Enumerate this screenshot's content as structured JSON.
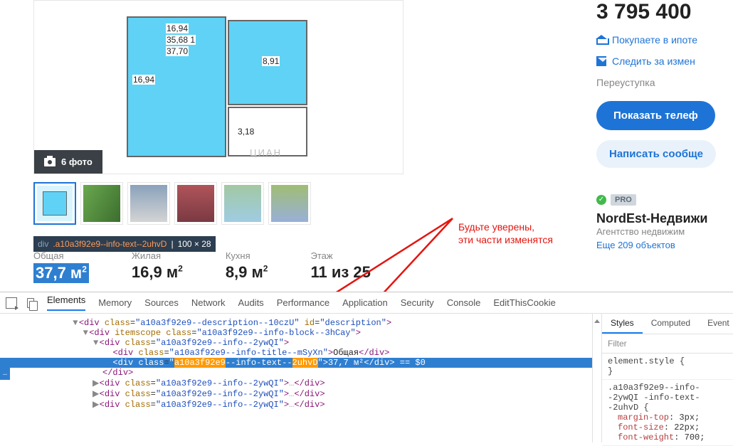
{
  "floorplan": {
    "labels": [
      "16,94",
      "35,68  1",
      "37,70",
      "16,94",
      "8,91",
      "3,18"
    ],
    "watermark": "ЦИАН"
  },
  "photo_badge": "6 фото",
  "thumbs_count": 6,
  "tooltip": {
    "prefix": "div",
    "cls": ".a10a3f92e9--info-text--2uhvD",
    "dim_sep": " | ",
    "dims": "100 × 28"
  },
  "stats": [
    {
      "label": "Общая",
      "value": "37,7 м",
      "sup": "2",
      "selected": true
    },
    {
      "label": "Жилая",
      "value": "16,9 м",
      "sup": "2",
      "selected": false
    },
    {
      "label": "Кухня",
      "value": "8,9 м",
      "sup": "2",
      "selected": false
    },
    {
      "label": "Этаж",
      "value": "11 из 25",
      "sup": "",
      "selected": false
    }
  ],
  "right": {
    "price": "3 795 400",
    "link_mortgage": "Покупаете в ипоте",
    "link_follow": "Следить за измен",
    "muted": "Переуступка",
    "btn_phone": "Показать телеф",
    "btn_msg": "Написать сообще",
    "pro_badge": "PRO",
    "agency_name": "NordEst-Недвижи",
    "agency_sub": "Агентство недвижим",
    "agency_more": "Еще 209 объектов"
  },
  "annotation": {
    "line1": "Будьте уверены,",
    "line2": "эти части изменятся"
  },
  "devtools": {
    "tabs": [
      "Elements",
      "Memory",
      "Sources",
      "Network",
      "Audits",
      "Performance",
      "Application",
      "Security",
      "Console",
      "EditThisCookie"
    ],
    "active_tab": "Elements",
    "styles_tabs": [
      "Styles",
      "Computed",
      "Event"
    ],
    "filter_placeholder": "Filter",
    "elements": {
      "l1": {
        "cls": "a10a3f92e9--description--10czU",
        "id": "description"
      },
      "l2": {
        "cls": "a10a3f92e9--info-block--3hCay"
      },
      "l3": {
        "cls": "a10a3f92e9--info--2ywQI"
      },
      "l4": {
        "cls": "a10a3f92e9--info-title--mSyXn",
        "txt": "Общая"
      },
      "l5": {
        "pre": "a10a3f92e9",
        "mid": "-info-text-",
        "suf": "2uhvD",
        "txt": "37,7 м²",
        "rest": " == $0"
      },
      "l6": "</div>",
      "l7": {
        "cls": "a10a3f92e9--info--2ywQI"
      },
      "l8": {
        "cls": "a10a3f92e9--info--2ywQI"
      },
      "l9": {
        "cls": "a10a3f92e9--info--2ywQI"
      }
    },
    "styles": {
      "rule1_sel": "element.style",
      "rule2_sel": ".a10a3f92e9--info--2ywQI -info-text--2uhvD",
      "rule2_props": [
        {
          "n": "margin-top",
          "v": "3px"
        },
        {
          "n": "font-size",
          "v": "22px"
        },
        {
          "n": "font-weight",
          "v": "700"
        }
      ]
    }
  }
}
